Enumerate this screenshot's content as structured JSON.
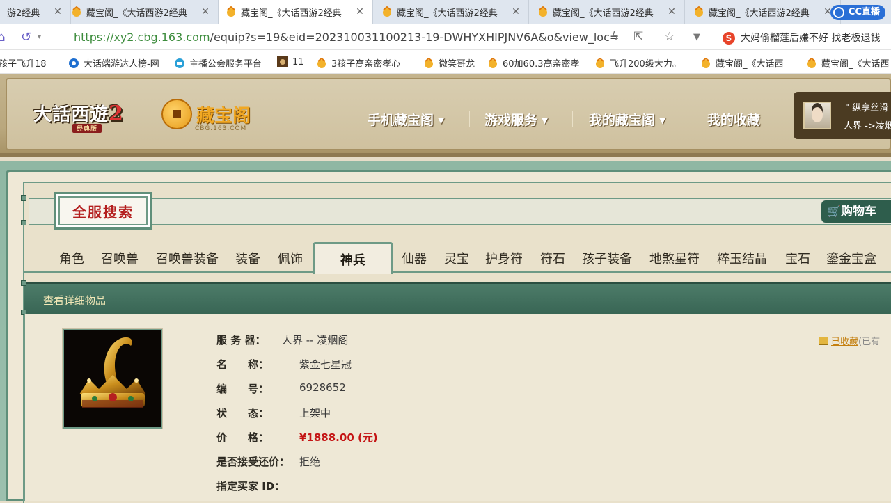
{
  "browser": {
    "tabs": [
      {
        "title": "游2经典",
        "active": false
      },
      {
        "title": "藏宝阁_《大话西游2经典",
        "active": false
      },
      {
        "title": "藏宝阁_《大话西游2经典",
        "active": true
      },
      {
        "title": "藏宝阁_《大话西游2经典",
        "active": false
      },
      {
        "title": "藏宝阁_《大话西游2经典",
        "active": false
      },
      {
        "title": "藏宝阁_《大话西游2经典",
        "active": false
      }
    ],
    "close_glyph": "✕",
    "brand": "CC直播",
    "url_host": "https://xy2.cbg.163.com",
    "url_path": "/equip?s=19&eid=202310031100213-19-DWHYXHIPJNV6A&o&view_loc=",
    "news": "大妈偷榴莲后嫌不好 找老板退钱",
    "bookmarks": [
      "孩子飞升18",
      "大话端游达人榜-网",
      "主播公会服务平台",
      "11",
      "3孩子高亲密孝心",
      "微笑哥龙",
      "60加60.3高亲密孝",
      "飞升200级大力。",
      "藏宝阁_《大话西",
      "藏宝阁_《大话西"
    ]
  },
  "header": {
    "game_logo": "大話西遊",
    "game_logo_num": "2",
    "game_logo_sub": "经典版",
    "cbg_logo": "藏宝阁",
    "cbg_domain": "CBG.163.COM",
    "nav": [
      {
        "label": "手机藏宝阁",
        "caret": "▼"
      },
      {
        "label": "游戏服务",
        "caret": "▼"
      },
      {
        "label": "我的藏宝阁",
        "caret": "▼"
      },
      {
        "label": "我的收藏",
        "caret": ""
      }
    ],
    "user_name": "\" 纵享丝滑",
    "user_server": "人界 ->凌烟"
  },
  "search": {
    "badge": "全服搜索",
    "cart": "购物车",
    "categories": [
      "角色",
      "召唤兽",
      "召唤兽装备",
      "装备",
      "佩饰",
      "神兵",
      "仙器",
      "灵宝",
      "护身符",
      "符石",
      "孩子装备",
      "地煞星符",
      "粹玉结晶",
      "宝石",
      "鎏金宝盒"
    ],
    "active_category": "神兵"
  },
  "detail": {
    "heading": "查看详细物品",
    "rows": [
      {
        "label": "服 务 器：",
        "value": "人界 -- 凌烟阁"
      },
      {
        "label": "名　　称：",
        "value": "紫金七星冠"
      },
      {
        "label": "编　　号：",
        "value": "6928652"
      },
      {
        "label": "状　　态：",
        "value": "上架中"
      },
      {
        "label": "价　　格：",
        "value": "¥1888.00 (元)"
      },
      {
        "label": "是否接受还价：",
        "value": "拒绝"
      },
      {
        "label": "指定买家 ID：",
        "value": ""
      }
    ],
    "fav_label": "已收藏",
    "fav_extra": "(已有"
  },
  "colors": {
    "accent_green": "#5f8f7a",
    "price_red": "#c41414",
    "badge_red": "#b41f1f"
  }
}
